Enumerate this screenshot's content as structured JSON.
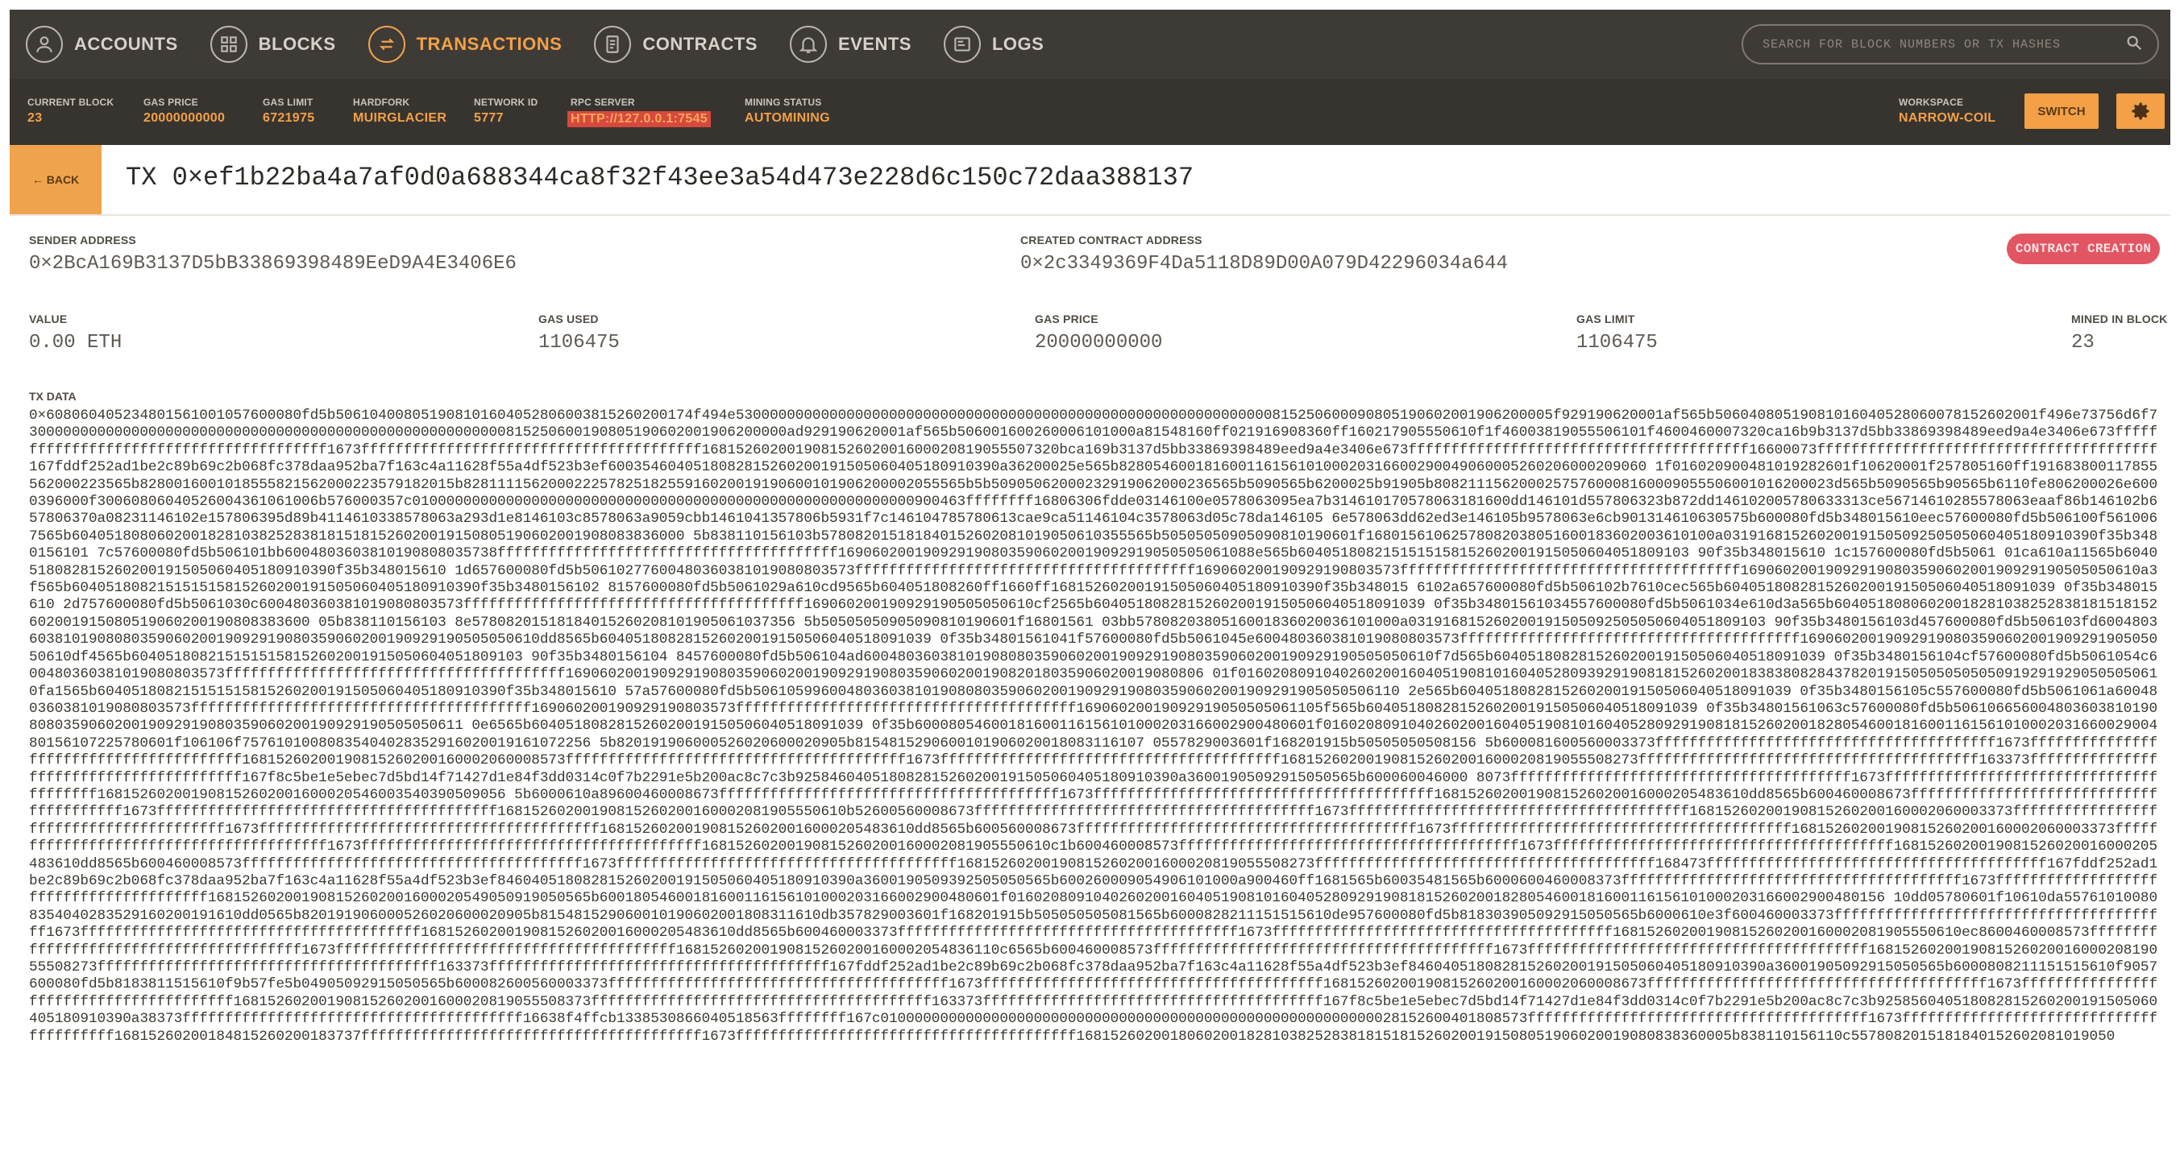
{
  "nav": {
    "tabs": [
      {
        "label": "ACCOUNTS",
        "icon": "account-icon",
        "active": false
      },
      {
        "label": "BLOCKS",
        "icon": "blocks-icon",
        "active": false
      },
      {
        "label": "TRANSACTIONS",
        "icon": "transactions-icon",
        "active": true
      },
      {
        "label": "CONTRACTS",
        "icon": "contracts-icon",
        "active": false
      },
      {
        "label": "EVENTS",
        "icon": "bell-icon",
        "active": false
      },
      {
        "label": "LOGS",
        "icon": "logs-icon",
        "active": false
      }
    ],
    "search_placeholder": "SEARCH FOR BLOCK NUMBERS OR TX HASHES"
  },
  "status": {
    "current_block": {
      "label": "CURRENT BLOCK",
      "value": "23"
    },
    "gas_price": {
      "label": "GAS PRICE",
      "value": "20000000000"
    },
    "gas_limit": {
      "label": "GAS LIMIT",
      "value": "6721975"
    },
    "hardfork": {
      "label": "HARDFORK",
      "value": "MUIRGLACIER"
    },
    "network_id": {
      "label": "NETWORK ID",
      "value": "5777"
    },
    "rpc_server": {
      "label": "RPC SERVER",
      "value": "HTTP://127.0.0.1:7545"
    },
    "mining_status": {
      "label": "MINING STATUS",
      "value": "AUTOMINING"
    },
    "workspace": {
      "label": "WORKSPACE",
      "value": "NARROW-COIL"
    },
    "switch_label": "SWITCH"
  },
  "transaction": {
    "back_label": "← BACK",
    "title": "TX 0×ef1b22ba4a7af0d0a688344ca8f32f43ee3a54d473e228d6c150c72daa388137",
    "sender_label": "SENDER ADDRESS",
    "sender": "0×2BcA169B3137D5bB33869398489EeD9A4E3406E6",
    "created_contract_label": "CREATED CONTRACT ADDRESS",
    "created_contract": "0×2c3349369F4Da5118D89D00A079D42296034a644",
    "badge": "CONTRACT CREATION",
    "value_label": "VALUE",
    "value": "0.00 ETH",
    "gas_used_label": "GAS USED",
    "gas_used": "1106475",
    "gas_price_label": "GAS PRICE",
    "gas_price": "20000000000",
    "gas_limit_label": "GAS LIMIT",
    "gas_limit": "1106475",
    "mined_label": "MINED IN BLOCK",
    "mined": "23",
    "tx_data_label": "TX DATA",
    "tx_data": "0×608060405234801561001057600080fd5b506104008051908101604052806003815260200174f494e530000000000000000000000000000000000000000000000000000000000000815250600090805190602001906200005f929190620001af565b50604080519081016040528060078152602001f496e73756d6f730000000000000000000000000000000000000000000000000000000815250600190805190602001906200000ad929190620001af565b506001600260006101000a81548160ff021916908360ff160217905550610f1f46003819055506101f4600460007320ca16b9b3137d5bb33869398489eed9a4e3406e673ffffffffffffffffffffffffffffffffffffffff1673ffffffffffffffffffffffffffffffffffffffff168152602001908152602001600020819055507320bca169b3137d5bb33869398489eed9a4e3406e673ffffffffffffffffffffffffffffffffffffffff16600073ffffffffffffffffffffffffffffffffffffffff167fddf252ad1be2c89b69c2b068fc378daa952ba7f163c4a11628f55a4df523b3ef6003546040518082815260200191505060405180910390a36200025e565b82805460018160011615610100020316600290049060005260206000209060 1f016020900481019282601f10620001f257805160ff191683800117855562000223565b8280016001018555821562000223579182015b82811115620002225782518255916020019190600101906200002055565b5b50905062000232919062000236565b5090565b6200025b91905b80821115620002575760008160009055506001016200023d565b5090565b90565b6110fe806200026e6000396000f30060806040526004361061006b576000357c01000000000000000000000000000000000000000000000000000000000900463ffffffff16806306fdde03146100e0578063095ea7b314610170578063181600dd146101d557806323b872dd146102005780633313ce56714610285578063eaaf86b146102b657806370a08231146102e157806395d89b4114610338578063a293d1e8146103c8578063a9059cbb1461041357806b5931f7c146104785780613cae9ca51146104c3578063d05c78da146105 6e578063dd62ed3e146105b9578063e6cb901314610630575b600080fd5b348015610eec57600080fd5b506100f5610067565b604051808060200182810382528381815181526020019150805190602001908083836000 5b838110156103b578082015181840152602081019050610355565b50505050905090810190601f16801561062578082038051600183602003610100a03191681526020019150509250505060405180910390f35b3480156101 7c57600080fd5b506101bb6004803603810190808035738ffffffffffffffffffffffffffffffffffffffff1690602001909291908035906020019092919050505061088e565b6040518082151515158152602001915050604051809103 90f35b348015610 1c157600080fd5b5061 01ca610a11565b6040518082815260200191505060405180910390f35b348015610 1d657600080fd5b50610277600480360381019080803573ffffffffffffffffffffffffffffffffffffffff169060200190929190803573ffffffffffffffffffffffffffffffffffffffff16906020019092919080359060200190929190505050610a3f565b604051808215151515815260200191505060405180910390f35b3480156102 8157600080fd5b5061029a610cd9565b604051808260ff1660ff16815260200191505060405180910390f35b348015 6102a657600080fd5b506102b7610cec565b604051808281526020019150506040518091039 0f35b348015610 2d757600080fd5b5061030c600480360381019080803573ffffffffffffffffffffffffffffffffffffffff169060200190929190505050610cf2565b604051808281526020019150506040518091039 0f35b34801561034557600080fd5b5061034e610d3a565b60405180806020018281038252838181518152602001915080519060200190808383600 05b838110156103 8e57808201518184015260208101905061037356 5b50505050905090810190601f16801561 03bb5780820380516001836020036101000a031916815260200191505092505050604051809103 90f35b3480156103d457600080fd5b506103fd6004803603810190808035906020019092919080359060200190929190505050610dd8565b604051808281526020019150506040518091039 0f35b34801561041f57600080fd5b5061045e600480360381019080803573ffffffffffffffffffffffffffffffffffffffff16906020019092919080359060200190929190505050610df4565b6040518082151515158152602001915050604051809103 90f35b3480156104 8457600080fd5b506104ad6004803603810190808035906020019092919080359060200190929190505050610f7d565b604051808281526020019150506040518091039 0f35b3480156104cf57600080fd5b5061054c600480360381019080803573ffffffffffffffffffffffffffffffffffffffff169060200190929190803590602001909291908035906020019082018035906020019080806 01f016020809104026020016040519081016040528093929190818152602001838380828437820191505050505050919291929050505061 0fa1565b604051808215151515815260200191505060405180910390f35b348015610 57a57600080fd5b5061059960048036038101908080359060200190929190803590602001909291905050506110 2e565b604051808281526020019150506040518091039 0f35b3480156105c557600080fd5b5061061a600480360381019080803573ffffffffffffffffffffffffffffffffffffffff169060200190929190803573ffffffffffffffffffffffffffffffffffffffff16906020019092919050505061105f565b604051808281526020019150506040518091039 0f35b34801561063c57600080fd5b506106656004803603810190808035906020019092919080359060200190929190505050611 0e6565b604051808281526020019150506040518091039 0f35b60008054600181600116156101000203166002900480601f0160208091040260200160405190810160405280929190818152602001828054600181600116156101000203166002900480156107225780601f106106f75761010080835404028352916020019161072256 5b820191906000526020600020905b8154815290600101906020018083116107 0557829003601f168201915b50505050508156 5b600081600560003373ffffffffffffffffffffffffffffffffffffffff1673ffffffffffffffffffffffffffffffffffffffff16815260200190815260200160002060008573ffffffffffffffffffffffffffffffffffffffff1673ffffffffffffffffffffffffffffffffffffffff168152602001908152602001600020819055508273ffffffffffffffffffffffffffffffffffffffff163373ffffffffffffffffffffffffffffffffffffffff167f8c5be1e5ebec7d5bd14f71427d1e84f3dd0314c0f7b2291e5b200ac8c7c3b925846040518082815260200191505060405180910390a36001905092915050565b600060046000 8073ffffffffffffffffffffffffffffffffffffffff1673ffffffffffffffffffffffffffffffffffffffff168152602001908152602001600020546003540390509056 5b6000610a89600460008673ffffffffffffffffffffffffffffffffffffffff1673ffffffffffffffffffffffffffffffffffffffff1681526020019081526020016000205483610dd8565b600460008673ffffffffffffffffffffffffffffffffffffffff1673ffffffffffffffffffffffffffffffffffffffff16815260200190815260200160002081905550610b52600560008673ffffffffffffffffffffffffffffffffffffffff1673ffffffffffffffffffffffffffffffffffffffff16815260200190815260200160002060003373ffffffffffffffffffffffffffffffffffffffff1673ffffffffffffffffffffffffffffffffffffffff1681526020019081526020016000205483610dd8565b600560008673ffffffffffffffffffffffffffffffffffffffff1673ffffffffffffffffffffffffffffffffffffffff16815260200190815260200160002060003373ffffffffffffffffffffffffffffffffffffffff1673ffffffffffffffffffffffffffffffffffffffff16815260200190815260200160002081905550610c1b600460008573ffffffffffffffffffffffffffffffffffffffff1673ffffffffffffffffffffffffffffffffffffffff1681526020019081526020016000205483610dd8565b600460008573ffffffffffffffffffffffffffffffffffffffff1673ffffffffffffffffffffffffffffffffffffffff168152602001908152602001600020819055508273ffffffffffffffffffffffffffffffffffffffff168473ffffffffffffffffffffffffffffffffffffffff167fddf252ad1be2c89b69c2b068fc378daa952ba7f163c4a11628f55a4df523b3ef846040518082815260200191505060405180910390a3600190509392505050565b600260009054906101000a900460ff1681565b60035481565b6000600460008373ffffffffffffffffffffffffffffffffffffffff1673ffffffffffffffffffffffffffffffffffffffff168152602001908152602001600020549050919050565b60018054600181600116156101000203166002900480601f0160208091040260200160405190810160405280929190818152602001828054600181600116156101000203166002900480156 10dd05780601f10610da557610100808354040283529160200191610dd0565b820191906000526020600020905b815481529060010190602001808311610db357829003601f168201915b505050505081565b6000828211151515610de957600080fd5b818303905092915050565b6000610e3f600460003373ffffffffffffffffffffffffffffffffffffffff1673ffffffffffffffffffffffffffffffffffffffff1681526020019081526020016000205483610dd8565b600460003373ffffffffffffffffffffffffffffffffffffffff1673ffffffffffffffffffffffffffffffffffffffff16815260200190815260200160002081905550610ec8600460008573ffffffffffffffffffffffffffffffffffffffff1673ffffffffffffffffffffffffffffffffffffffff16815260200190815260200160002054836110c6565b600460008573ffffffffffffffffffffffffffffffffffffffff1673ffffffffffffffffffffffffffffffffffffffff168152602001908152602001600020819055508273ffffffffffffffffffffffffffffffffffffffff163373ffffffffffffffffffffffffffffffffffffffff167fddf252ad1be2c89b69c2b068fc378daa952ba7f163c4a11628f55a4df523b3ef846040518082815260200191505060405180910390a36001905092915050565b6000808211151515610f9057600080fd5b8183811515610f9b57fe5b04905092915050565b600082600560003373ffffffffffffffffffffffffffffffffffffffff1673ffffffffffffffffffffffffffffffffffffffff16815260200190815260200160002060008673ffffffffffffffffffffffffffffffffffffffff1673ffffffffffffffffffffffffffffffffffffffff168152602001908152602001600020819055508373ffffffffffffffffffffffffffffffffffffffff163373ffffffffffffffffffffffffffffffffffffffff167f8c5be1e5ebec7d5bd14f71427d1e84f3dd0314c0f7b2291e5b200ac8c7c3b925856040518082815260200191505060405180910390a38373ffffffffffffffffffffffffffffffffffffffff16638f4ffcb1338530866040518563ffffffff167c0100000000000000000000000000000000000000000000000000000000028152600401808573ffffffffffffffffffffffffffffffffffffffff1673ffffffffffffffffffffffffffffffffffffffff16815260200184815260200183737ffffffffffffffffffffffffffffffffffffffff1673ffffffffffffffffffffffffffffffffffffffff16815260200180602001828103825283818151815260200191508051906020019080838360005b838110156110c5578082015181840152602081019050"
  },
  "colors": {
    "nav_bg": "#3e3b37",
    "status_bg": "#37342f",
    "accent": "#f3a047",
    "badge": "#e25563"
  }
}
